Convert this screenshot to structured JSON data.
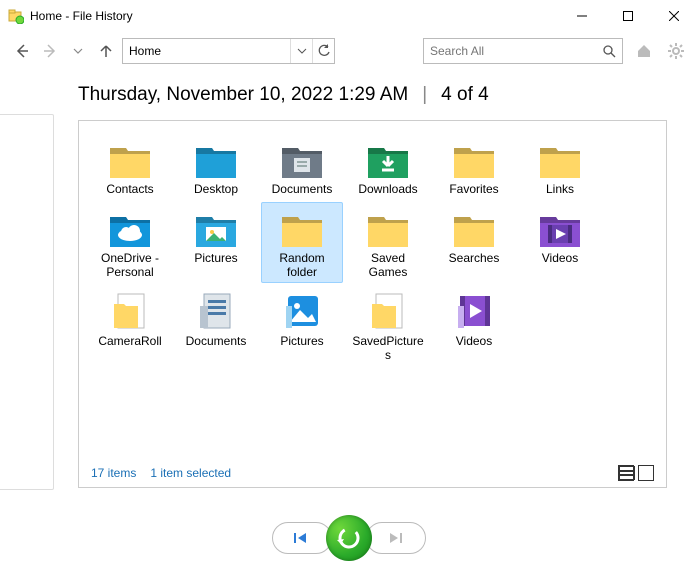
{
  "window": {
    "title": "Home - File History"
  },
  "toolbar": {
    "address_value": "Home",
    "search_placeholder": "Search All"
  },
  "header": {
    "datetime": "Thursday, November 10, 2022 1:29 AM",
    "position": "4 of 4"
  },
  "items": [
    {
      "name": "Contacts",
      "icon": "folder-yellow",
      "selected": false,
      "type": "folder"
    },
    {
      "name": "Desktop",
      "icon": "folder-blue",
      "selected": false,
      "type": "folder"
    },
    {
      "name": "Documents",
      "icon": "folder-gray",
      "selected": false,
      "type": "folder"
    },
    {
      "name": "Downloads",
      "icon": "folder-green-dl",
      "selected": false,
      "type": "folder"
    },
    {
      "name": "Favorites",
      "icon": "folder-yellow",
      "selected": false,
      "type": "folder"
    },
    {
      "name": "Links",
      "icon": "folder-yellow",
      "selected": false,
      "type": "folder"
    },
    {
      "name": "OneDrive - Personal",
      "icon": "folder-cloud",
      "selected": false,
      "type": "folder"
    },
    {
      "name": "Pictures",
      "icon": "folder-pictures",
      "selected": false,
      "type": "folder"
    },
    {
      "name": "Random folder",
      "icon": "folder-yellow",
      "selected": true,
      "type": "folder"
    },
    {
      "name": "Saved Games",
      "icon": "folder-yellow",
      "selected": false,
      "type": "folder"
    },
    {
      "name": "Searches",
      "icon": "folder-yellow",
      "selected": false,
      "type": "folder"
    },
    {
      "name": "Videos",
      "icon": "folder-videos",
      "selected": false,
      "type": "folder"
    },
    {
      "name": "CameraRoll",
      "icon": "lib-yellow",
      "selected": false,
      "type": "library"
    },
    {
      "name": "Documents",
      "icon": "lib-doc",
      "selected": false,
      "type": "library"
    },
    {
      "name": "Pictures",
      "icon": "lib-picture",
      "selected": false,
      "type": "library"
    },
    {
      "name": "SavedPictures",
      "icon": "lib-yellow",
      "selected": false,
      "type": "library"
    },
    {
      "name": "Videos",
      "icon": "lib-video",
      "selected": false,
      "type": "library"
    }
  ],
  "status": {
    "count_text": "17 items",
    "selection_text": "1 item selected"
  },
  "icon_colors": {
    "folder-yellow": "#ffd766",
    "folder-blue": "#1fa0d8",
    "folder-gray": "#6f7b88",
    "folder-green": "#1fa060",
    "folder-cloud": "#1296db",
    "folder-pictures": "#2aa8e0",
    "folder-videos": "#8a4fd1",
    "lib-doc": "#4a7aa8",
    "lib-picture": "#1d8fe0",
    "lib-video": "#8a4fd1"
  }
}
